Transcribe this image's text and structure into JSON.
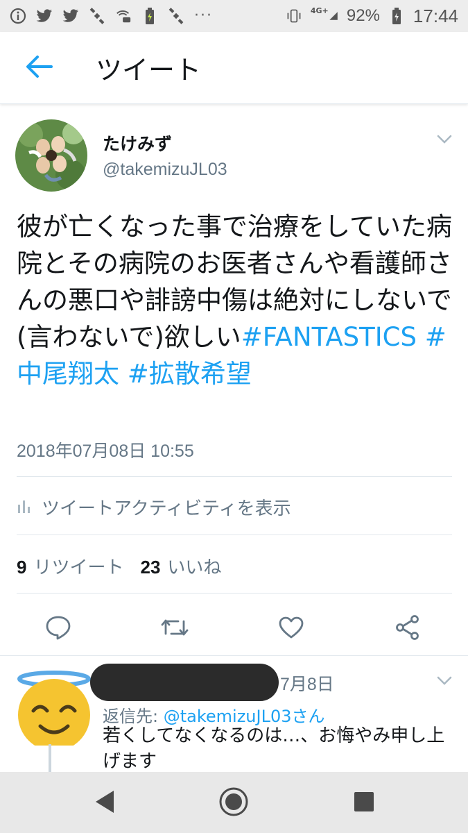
{
  "status_bar": {
    "battery": "92%",
    "time": "17:44",
    "network": "4G+",
    "more": "···"
  },
  "app_bar": {
    "title": "ツイート"
  },
  "tweet": {
    "author_name": "たけみず",
    "author_handle": "@takemizuJL03",
    "text": "彼が亡くなった事で治療をしていた病院とその病院のお医者さんや看護師さんの悪口や誹謗中傷は絶対にしないで(言わないで)欲しい",
    "hashtags": [
      "#FANTASTICS",
      "#中尾翔太",
      "#拡散希望"
    ],
    "timestamp": "2018年07月08日 10:55",
    "activity_label": "ツイートアクティビティを表示",
    "retweet_count": "9",
    "retweet_label": "リツイート",
    "like_count": "23",
    "like_label": "いいね"
  },
  "reply": {
    "date": "7月8日",
    "reply_to_prefix": "返信先: ",
    "reply_to_mention": "@takemizuJL03さん",
    "text": "若くしてなくなるのは…、お悔やみ申し上げます"
  },
  "colors": {
    "accent": "#1da1f2",
    "secondary_text": "#657786",
    "primary_text": "#14171a",
    "divider": "#e1e8ed",
    "redaction": "#2b2b2b"
  },
  "icons": {
    "back": "arrow-left-icon",
    "reply": "comment-icon",
    "retweet": "retweet-icon",
    "like": "heart-icon",
    "share": "share-icon",
    "activity": "bar-chart-icon"
  }
}
